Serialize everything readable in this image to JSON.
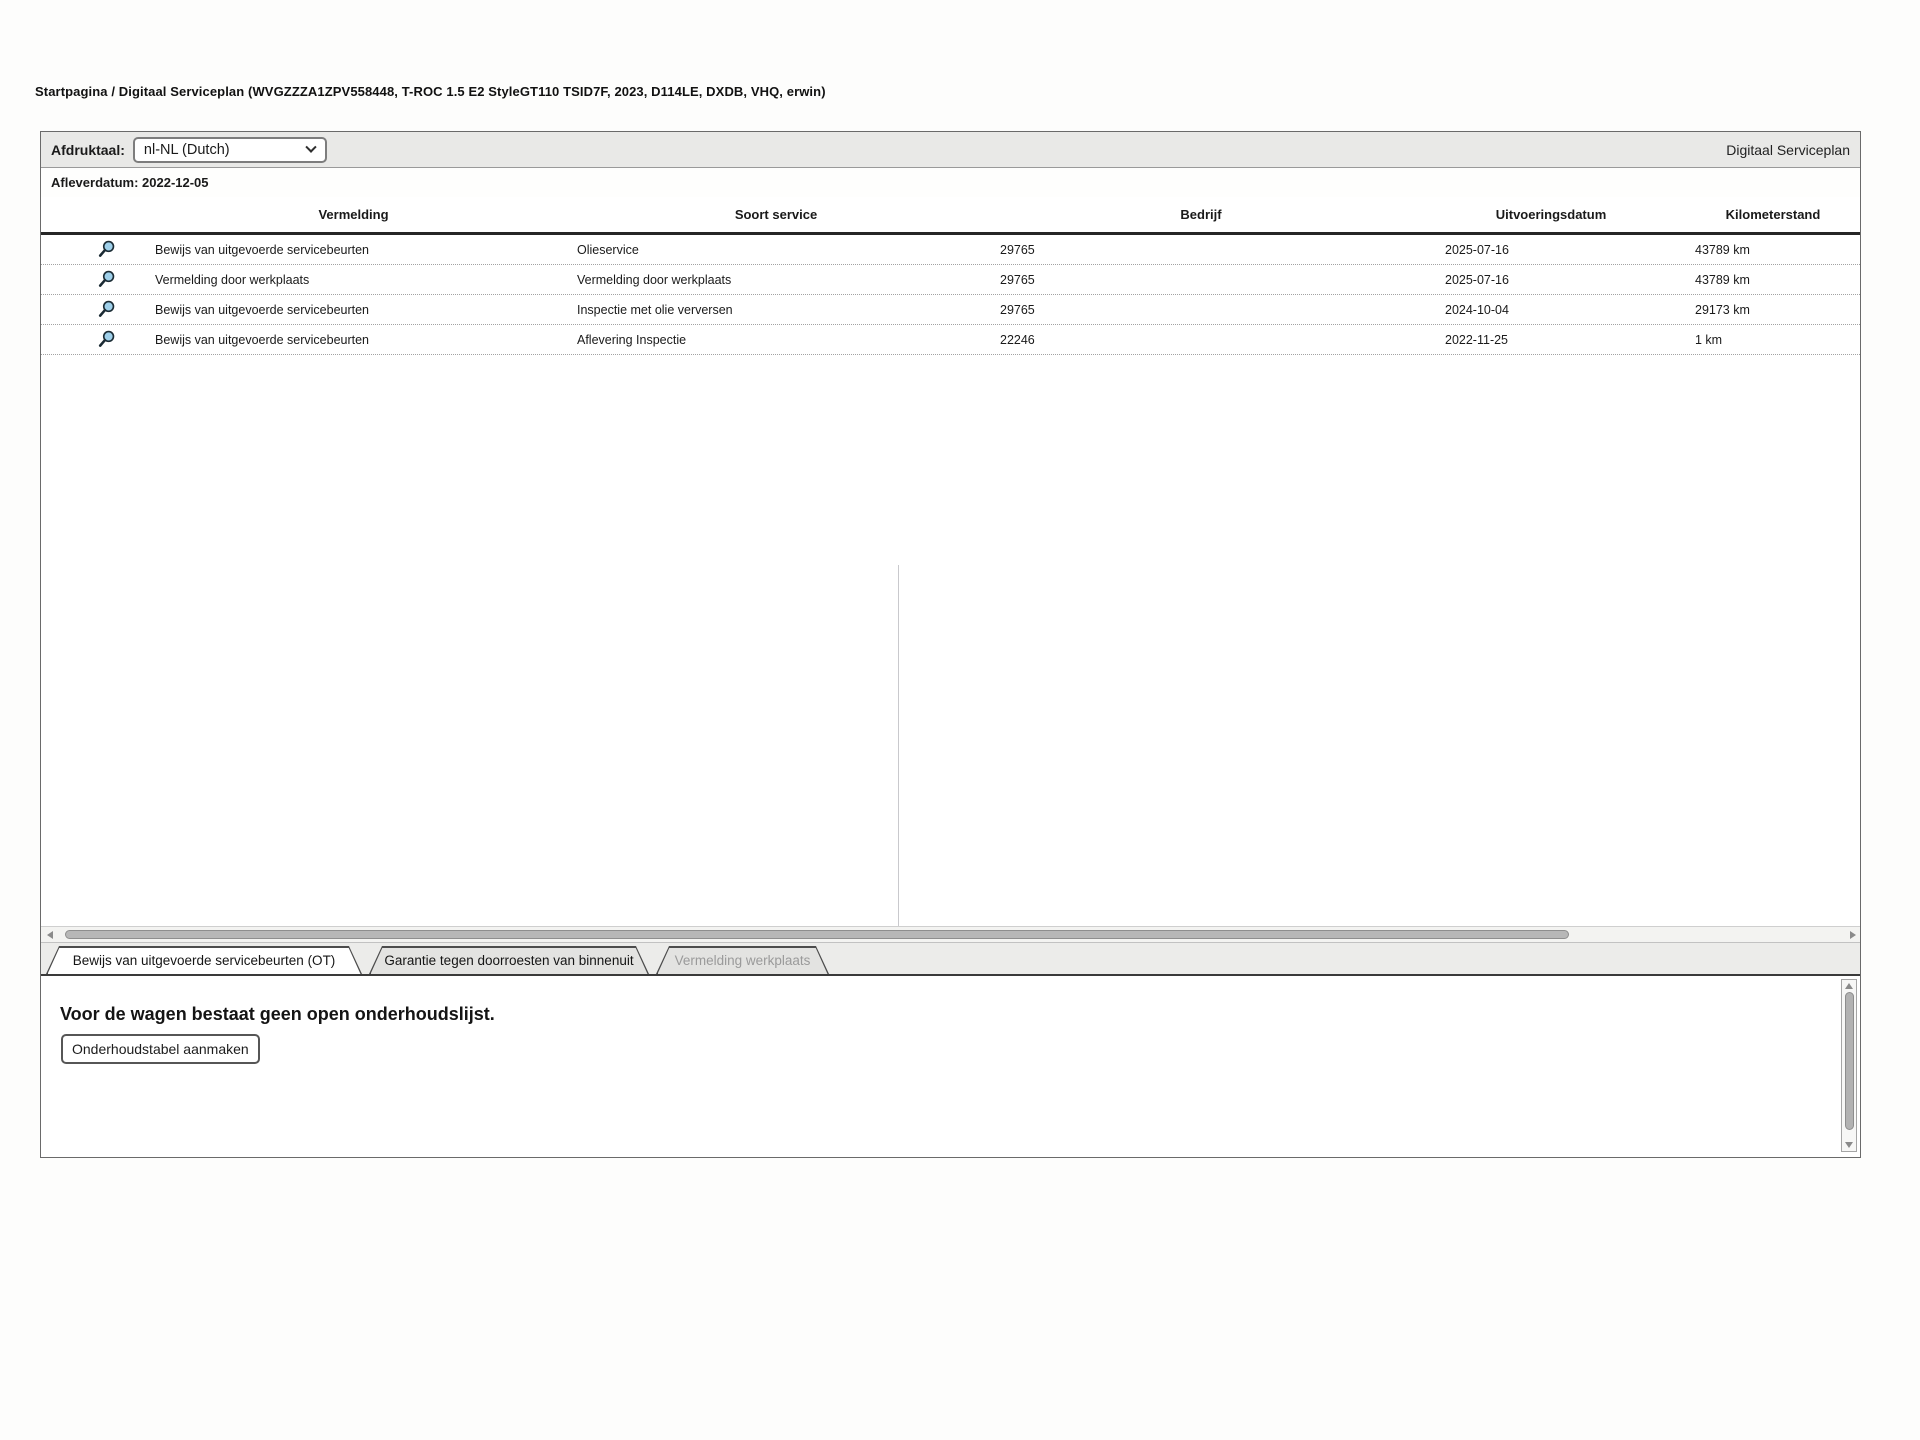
{
  "page": {
    "breadcrumb": "Startpagina / Digitaal Serviceplan (WVGZZZA1ZPV558448, T-ROC 1.5 E2 StyleGT110 TSID7F, 2023, D114LE, DXDB, VHQ, erwin)",
    "app_title": "Digitaal Serviceplan"
  },
  "toolbar": {
    "language_label": "Afdruktaal:",
    "language_value": "nl-NL (Dutch)",
    "delivery_date": "Afleverdatum: 2022-12-05"
  },
  "table": {
    "columns": [
      "Vermelding",
      "Soort service",
      "Bedrijf",
      "Uitvoeringsdatum",
      "Kilometerstand"
    ],
    "row_icon": "magnifier-icon",
    "rows": [
      {
        "vermelding": "Bewijs van uitgevoerde servicebeurten",
        "soort": "Olieservice",
        "bedrijf": "29765",
        "datum": "2025-07-16",
        "km": "43789 km"
      },
      {
        "vermelding": "Vermelding door werkplaats",
        "soort": "Vermelding door werkplaats",
        "bedrijf": "29765",
        "datum": "2025-07-16",
        "km": "43789 km"
      },
      {
        "vermelding": "Bewijs van uitgevoerde servicebeurten",
        "soort": "Inspectie met olie verversen",
        "bedrijf": "29765",
        "datum": "2024-10-04",
        "km": "29173 km"
      },
      {
        "vermelding": "Bewijs van uitgevoerde servicebeurten",
        "soort": "Aflevering Inspectie",
        "bedrijf": "22246",
        "datum": "2022-11-25",
        "km": "1 km"
      }
    ]
  },
  "tabs": [
    {
      "label": "Bewijs van uitgevoerde servicebeurten (OT)",
      "state": "active"
    },
    {
      "label": "Garantie tegen doorroesten van binnenuit",
      "state": "inactive"
    },
    {
      "label": "Vermelding werkplaats",
      "state": "disabled"
    }
  ],
  "bottom_panel": {
    "message": "Voor de wagen bestaat geen open onderhoudslijst.",
    "button_label": "Onderhoudstabel aanmaken"
  },
  "colors": {
    "magnifier_lens": "#9fd0ea",
    "magnifier_outline": "#1b2b34",
    "topbar_bg": "#e9e9e7",
    "tab_strip_bg": "#ececea",
    "scroll_thumb": "#b7b7b7"
  }
}
